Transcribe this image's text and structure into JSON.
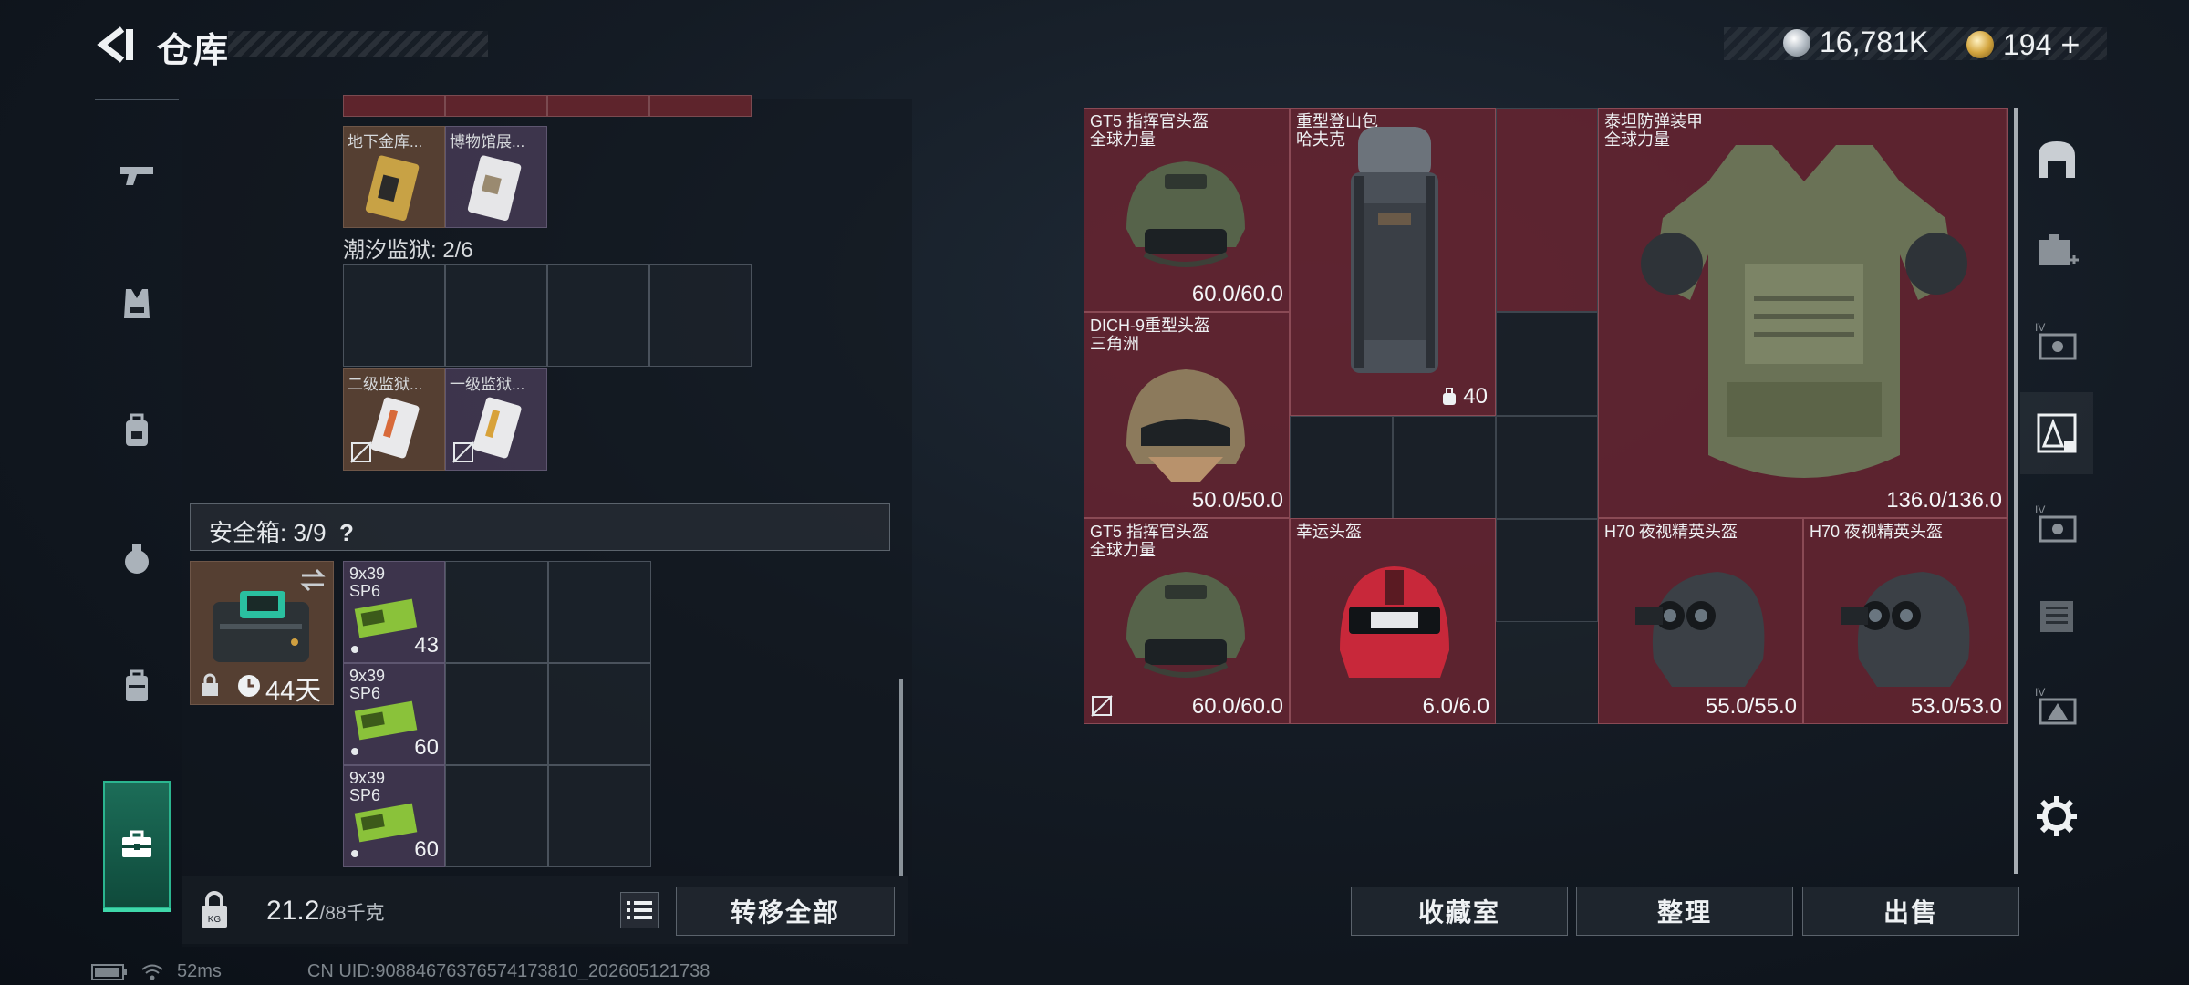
{
  "header": {
    "title": "仓库",
    "currency_main": "16,781K",
    "currency_premium": "194",
    "plus": "+"
  },
  "left_nav": [
    "weapon-icon",
    "armor-icon",
    "backpack-icon",
    "bag-icon",
    "case-icon",
    "toolbox-icon"
  ],
  "storage": {
    "top_items": [
      {
        "name": "地下金库..."
      },
      {
        "name": "博物馆展..."
      }
    ],
    "prison_label": "潮汐监狱: 2/6",
    "prison_items": [
      {
        "name": "二级监狱..."
      },
      {
        "name": "一级监狱..."
      }
    ]
  },
  "safebox": {
    "label": "安全箱: 3/9",
    "help": "?",
    "days": "44天",
    "ammo": [
      {
        "name_line1": "9x39",
        "name_line2": "SP6",
        "count": "43"
      },
      {
        "name_line1": "9x39",
        "name_line2": "SP6",
        "count": "60"
      },
      {
        "name_line1": "9x39",
        "name_line2": "SP6",
        "count": "60"
      }
    ]
  },
  "weight": {
    "current": "21.2",
    "max": "/88千克"
  },
  "buttons": {
    "transfer_all": "转移全部",
    "collection": "收藏室",
    "organize": "整理",
    "sell": "出售"
  },
  "equipment": [
    {
      "name_line1": "GT5 指挥官头盔",
      "name_line2": "全球力量",
      "durability": "60.0/60.0"
    },
    {
      "name_line1": "重型登山包",
      "name_line2": "哈夫克",
      "capacity": "40"
    },
    {
      "name_line1": "泰坦防弹装甲",
      "name_line2": "全球力量",
      "durability": "136.0/136.0"
    },
    {
      "name_line1": "DICH-9重型头盔",
      "name_line2": "三角洲",
      "durability": "50.0/50.0"
    },
    {
      "name_line1": "GT5 指挥官头盔",
      "name_line2": "全球力量",
      "durability": "60.0/60.0"
    },
    {
      "name_line1": "幸运头盔",
      "name_line2": "",
      "durability": "6.0/6.0"
    },
    {
      "name_line1": "H70 夜视精英头盔",
      "name_line2": "",
      "durability": "55.0/55.0"
    },
    {
      "name_line1": "H70 夜视精英头盔",
      "name_line2": "",
      "durability": "53.0/53.0"
    }
  ],
  "right_nav": [
    "helmet-rack-icon",
    "medkit-storage-icon",
    "tier4-case-icon",
    "armor-case-icon",
    "tier4-case-icon",
    "document-case-icon",
    "tier4-case-icon"
  ],
  "footer": {
    "ping": "52ms",
    "uid": "CN UID:9088467637657417381​0_202605121738"
  },
  "colors": {
    "accent_green": "#2bb58f",
    "item_red": "#76243a",
    "panel_dark": "#12181f"
  }
}
